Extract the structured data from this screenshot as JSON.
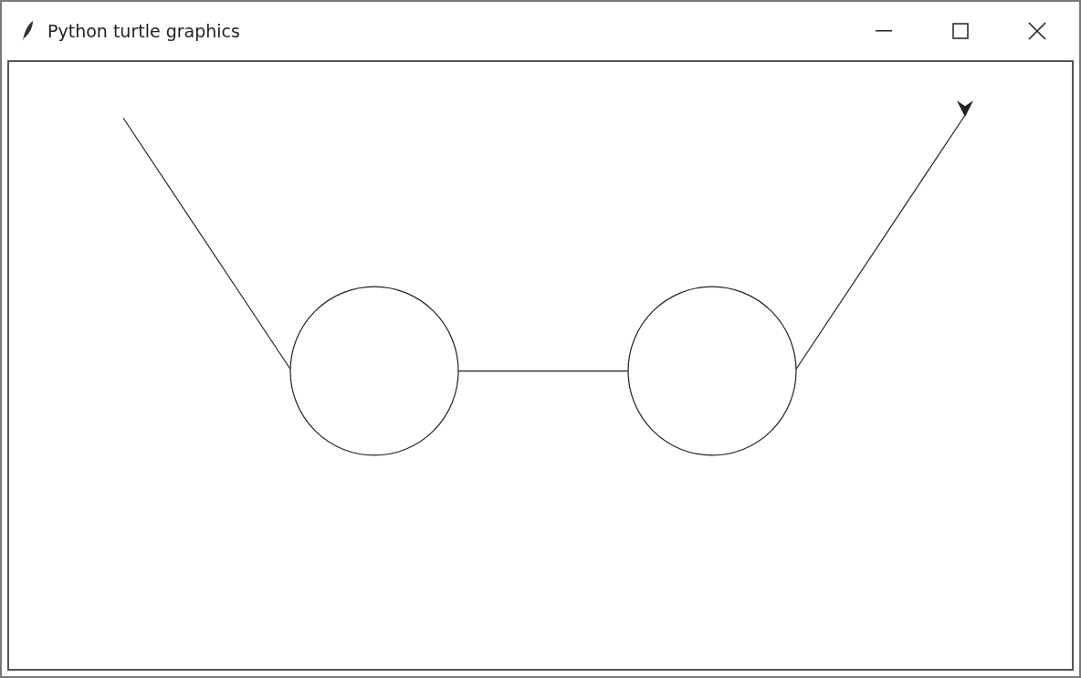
{
  "window": {
    "title": "Python turtle graphics"
  }
}
